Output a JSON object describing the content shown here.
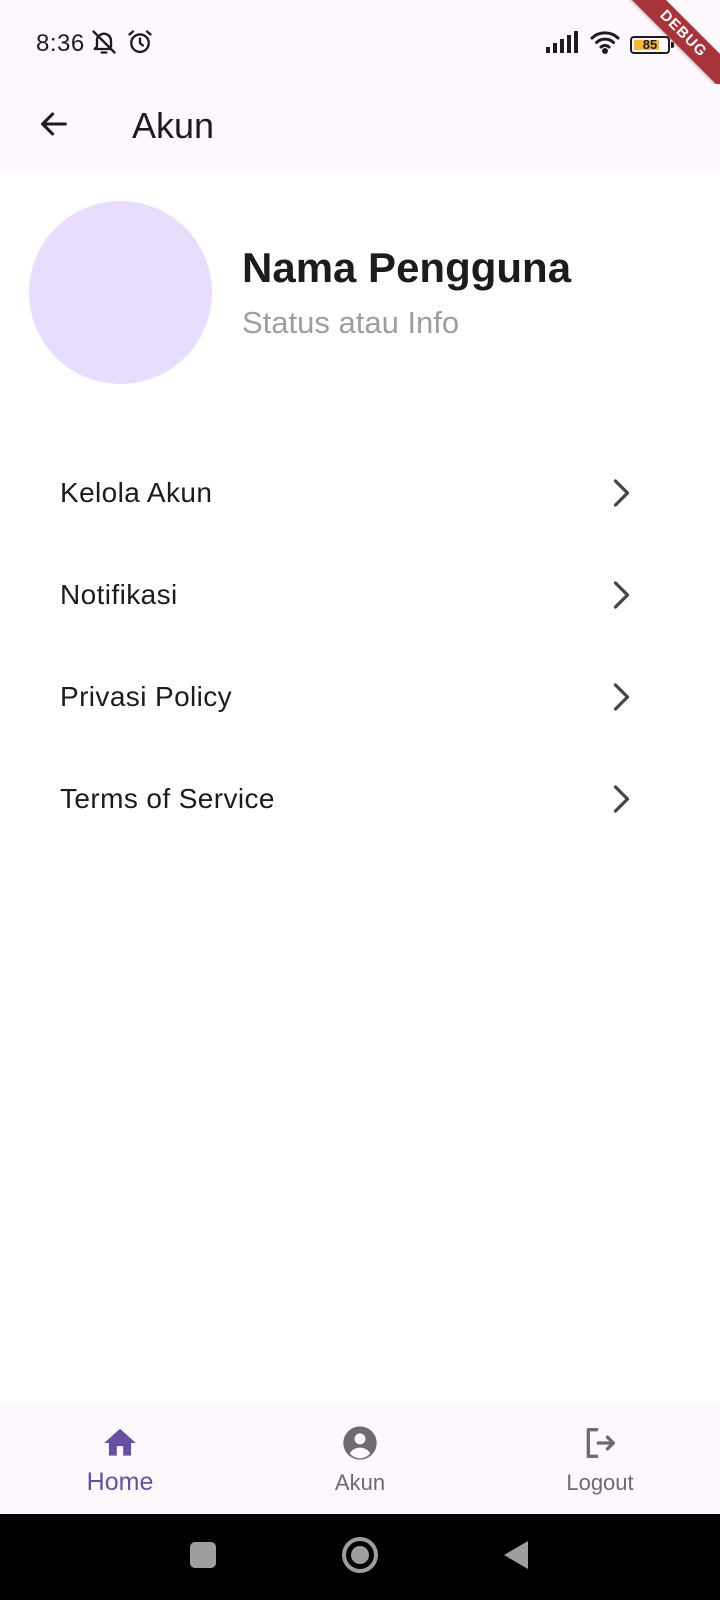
{
  "status_bar": {
    "time": "8:36",
    "battery_level": "85",
    "debug_label": "DEBUG"
  },
  "app_bar": {
    "title": "Akun"
  },
  "profile": {
    "name": "Nama Pengguna",
    "status": "Status atau Info"
  },
  "menu": {
    "items": [
      {
        "label": "Kelola Akun"
      },
      {
        "label": "Notifikasi"
      },
      {
        "label": "Privasi Policy"
      },
      {
        "label": "Terms of Service"
      }
    ]
  },
  "bottom_nav": {
    "items": [
      {
        "label": "Home",
        "icon": "home-icon",
        "active": true
      },
      {
        "label": "Akun",
        "icon": "account-circle-icon",
        "active": false
      },
      {
        "label": "Logout",
        "icon": "logout-icon",
        "active": false
      }
    ]
  },
  "colors": {
    "accent": "#6750a4",
    "surface": "#fdf7fe",
    "avatar_bg": "#e9ddff",
    "debug_ribbon": "#a8343a"
  }
}
